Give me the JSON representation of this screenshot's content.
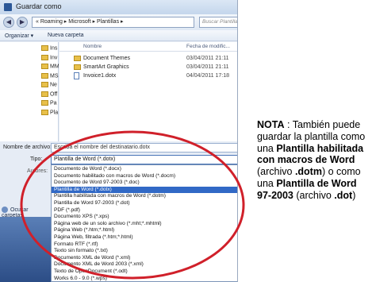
{
  "window": {
    "title": "Guardar como",
    "address": "« Roaming ▸ Microsoft ▸ Plantillas ▸",
    "search_placeholder": "Buscar Plantillas"
  },
  "toolbar": {
    "organize": "Organizar ▾",
    "new_folder": "Nueva carpeta"
  },
  "nav_items": [
    "Ins",
    "Inv",
    "MM",
    "MS",
    "Ne",
    "Off",
    "Pa",
    "Pla"
  ],
  "file_columns": {
    "name": "Nombre",
    "date": "Fecha de modific..."
  },
  "files": [
    {
      "name": "Document Themes",
      "date": "03/04/2011 21:11",
      "kind": "folder"
    },
    {
      "name": "SmartArt Graphics",
      "date": "03/04/2011 21:11",
      "kind": "folder"
    },
    {
      "name": "Invoice1.dotx",
      "date": "04/04/2011 17:18",
      "kind": "doc"
    }
  ],
  "form": {
    "filename_label": "Nombre de archivo:",
    "filename_value": "Escriba el nombre del destinatario.dotx",
    "type_label": "Tipo:",
    "type_value": "Plantilla de Word (*.dotx)",
    "authors_label": "Autores:",
    "hide_folders": "Ocultar carpetas"
  },
  "file_types": [
    "Documento de Word (*.docx)",
    "Documento habilitado con macros de Word (*.docm)",
    "Documento de Word 97-2003 (*.doc)",
    "Plantilla de Word (*.dotx)",
    "Plantilla habilitada con macros de Word (*.dotm)",
    "Plantilla de Word 97-2003 (*.dot)",
    "PDF (*.pdf)",
    "Documento XPS (*.xps)",
    "Página web de un solo archivo (*.mht;*.mhtml)",
    "Página Web (*.htm;*.html)",
    "Página Web, filtrada (*.htm;*.html)",
    "Formato RTF (*.rtf)",
    "Texto sin formato (*.txt)",
    "Documento XML de Word (*.xml)",
    "Documento XML de Word 2003 (*.xml)",
    "Texto de OpenDocument (*.odt)",
    "Works 6.0 - 9.0 (*.wps)"
  ],
  "selected_type_index": 3,
  "note": {
    "label": "NOTA",
    "t1": " : También puede guardar la plantilla como una ",
    "b1": "Plantilla habilitada con macros de Word",
    "t2": " (archivo ",
    "b2": ".dotm",
    "t3": ") o como una ",
    "b3": "Plantilla de Word 97-2003",
    "t4": " (archivo ",
    "b4": ".dot",
    "t5": ")"
  },
  "colors": {
    "highlight": "#3169c6",
    "annotation_ellipse": "#d0202a"
  }
}
